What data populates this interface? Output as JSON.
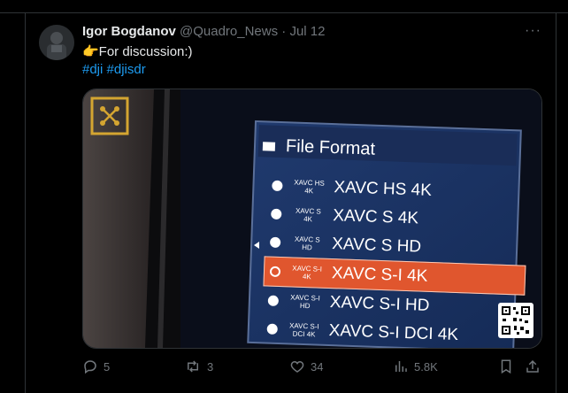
{
  "tweet": {
    "name": "Igor Bogdanov",
    "handle": "@Quadro_News",
    "separator": "·",
    "date": "Jul 12",
    "text": "👉For discussion:)",
    "hashtags": [
      "#dji",
      "#djisdr"
    ],
    "more": "···"
  },
  "media": {
    "title": "File Format",
    "options": [
      {
        "code1": "XAVC HS",
        "code2": "4K",
        "label": "XAVC HS 4K",
        "selected": false
      },
      {
        "code1": "XAVC S",
        "code2": "4K",
        "label": "XAVC S 4K",
        "selected": false
      },
      {
        "code1": "XAVC S",
        "code2": "HD",
        "label": "XAVC S HD",
        "selected": false
      },
      {
        "code1": "XAVC S-I",
        "code2": "4K",
        "label": "XAVC S-I 4K",
        "selected": true
      },
      {
        "code1": "XAVC S-I",
        "code2": "HD",
        "label": "XAVC S-I HD",
        "selected": false
      },
      {
        "code1": "XAVC S-I",
        "code2": "DCI 4K",
        "label": "XAVC S-I DCI 4K",
        "selected": false
      }
    ],
    "accent": "#e0562e",
    "logo_color": "#d4a531"
  },
  "actions": {
    "replies": "5",
    "reposts": "3",
    "likes": "34",
    "views": "5.8K"
  }
}
